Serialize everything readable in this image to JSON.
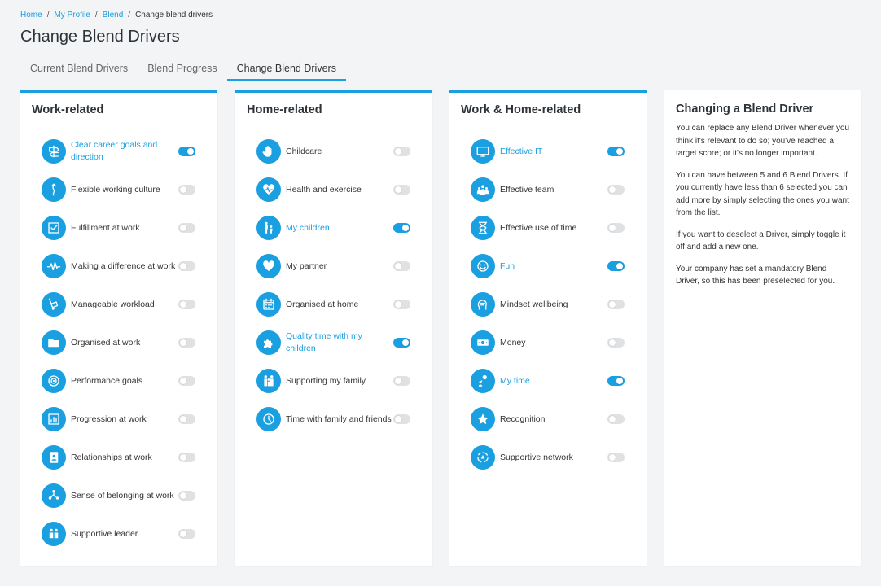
{
  "breadcrumb": {
    "home": "Home",
    "profile": "My Profile",
    "blend": "Blend",
    "current": "Change blend drivers"
  },
  "page_title": "Change Blend Drivers",
  "tabs": [
    "Current Blend Drivers",
    "Blend Progress",
    "Change Blend Drivers"
  ],
  "active_tab": "Change Blend Drivers",
  "accent_color": "#1a9fe0",
  "panels": [
    {
      "title": "Work-related",
      "items": [
        {
          "label": "Clear career goals and direction",
          "on": true,
          "icon": "signpost-icon"
        },
        {
          "label": "Flexible working culture",
          "on": false,
          "icon": "flexible-arrow-icon"
        },
        {
          "label": "Fulfillment at work",
          "on": false,
          "icon": "checkbox-icon"
        },
        {
          "label": "Making a difference at work",
          "on": false,
          "icon": "pulse-icon"
        },
        {
          "label": "Manageable workload",
          "on": false,
          "icon": "hand-truck-icon"
        },
        {
          "label": "Organised at work",
          "on": false,
          "icon": "folder-icon"
        },
        {
          "label": "Performance goals",
          "on": false,
          "icon": "target-icon"
        },
        {
          "label": "Progression at work",
          "on": false,
          "icon": "bar-chart-icon"
        },
        {
          "label": "Relationships at work",
          "on": false,
          "icon": "contact-book-icon"
        },
        {
          "label": "Sense of belonging at work",
          "on": false,
          "icon": "people-network-icon"
        },
        {
          "label": "Supportive leader",
          "on": false,
          "icon": "people-together-icon"
        }
      ]
    },
    {
      "title": "Home-related",
      "items": [
        {
          "label": "Childcare",
          "on": false,
          "icon": "hand-icon"
        },
        {
          "label": "Health and exercise",
          "on": false,
          "icon": "heartbeat-icon"
        },
        {
          "label": "My children",
          "on": true,
          "icon": "parent-child-icon"
        },
        {
          "label": "My partner",
          "on": false,
          "icon": "heart-icon"
        },
        {
          "label": "Organised at home",
          "on": false,
          "icon": "calendar-icon"
        },
        {
          "label": "Quality time with my children",
          "on": true,
          "icon": "puzzle-icon"
        },
        {
          "label": "Supporting my family",
          "on": false,
          "icon": "family-icon"
        },
        {
          "label": "Time with family and friends",
          "on": false,
          "icon": "clock-icon"
        }
      ]
    },
    {
      "title": "Work & Home-related",
      "items": [
        {
          "label": "Effective IT",
          "on": true,
          "icon": "monitor-icon"
        },
        {
          "label": "Effective team",
          "on": false,
          "icon": "team-icon"
        },
        {
          "label": "Effective use of time",
          "on": false,
          "icon": "hourglass-icon"
        },
        {
          "label": "Fun",
          "on": true,
          "icon": "smile-icon"
        },
        {
          "label": "Mindset wellbeing",
          "on": false,
          "icon": "head-icon"
        },
        {
          "label": "Money",
          "on": false,
          "icon": "banknote-icon"
        },
        {
          "label": "My time",
          "on": true,
          "icon": "person-thought-icon"
        },
        {
          "label": "Recognition",
          "on": false,
          "icon": "star-icon"
        },
        {
          "label": "Supportive network",
          "on": false,
          "icon": "network-cycle-icon"
        }
      ]
    }
  ],
  "info": {
    "title": "Changing a Blend Driver",
    "paragraphs": [
      "You can replace any Blend Driver whenever you think it's relevant to do so; you've reached a target score; or it's no longer important.",
      "You can have between 5 and 6 Blend Drivers. If you currently have less than 6 selected you can add more by simply selecting the ones you want from the list.",
      "If you want to deselect a Driver, simply toggle it off and add a new one.",
      "Your company has set a mandatory Blend Driver, so this has been preselected for you."
    ]
  }
}
